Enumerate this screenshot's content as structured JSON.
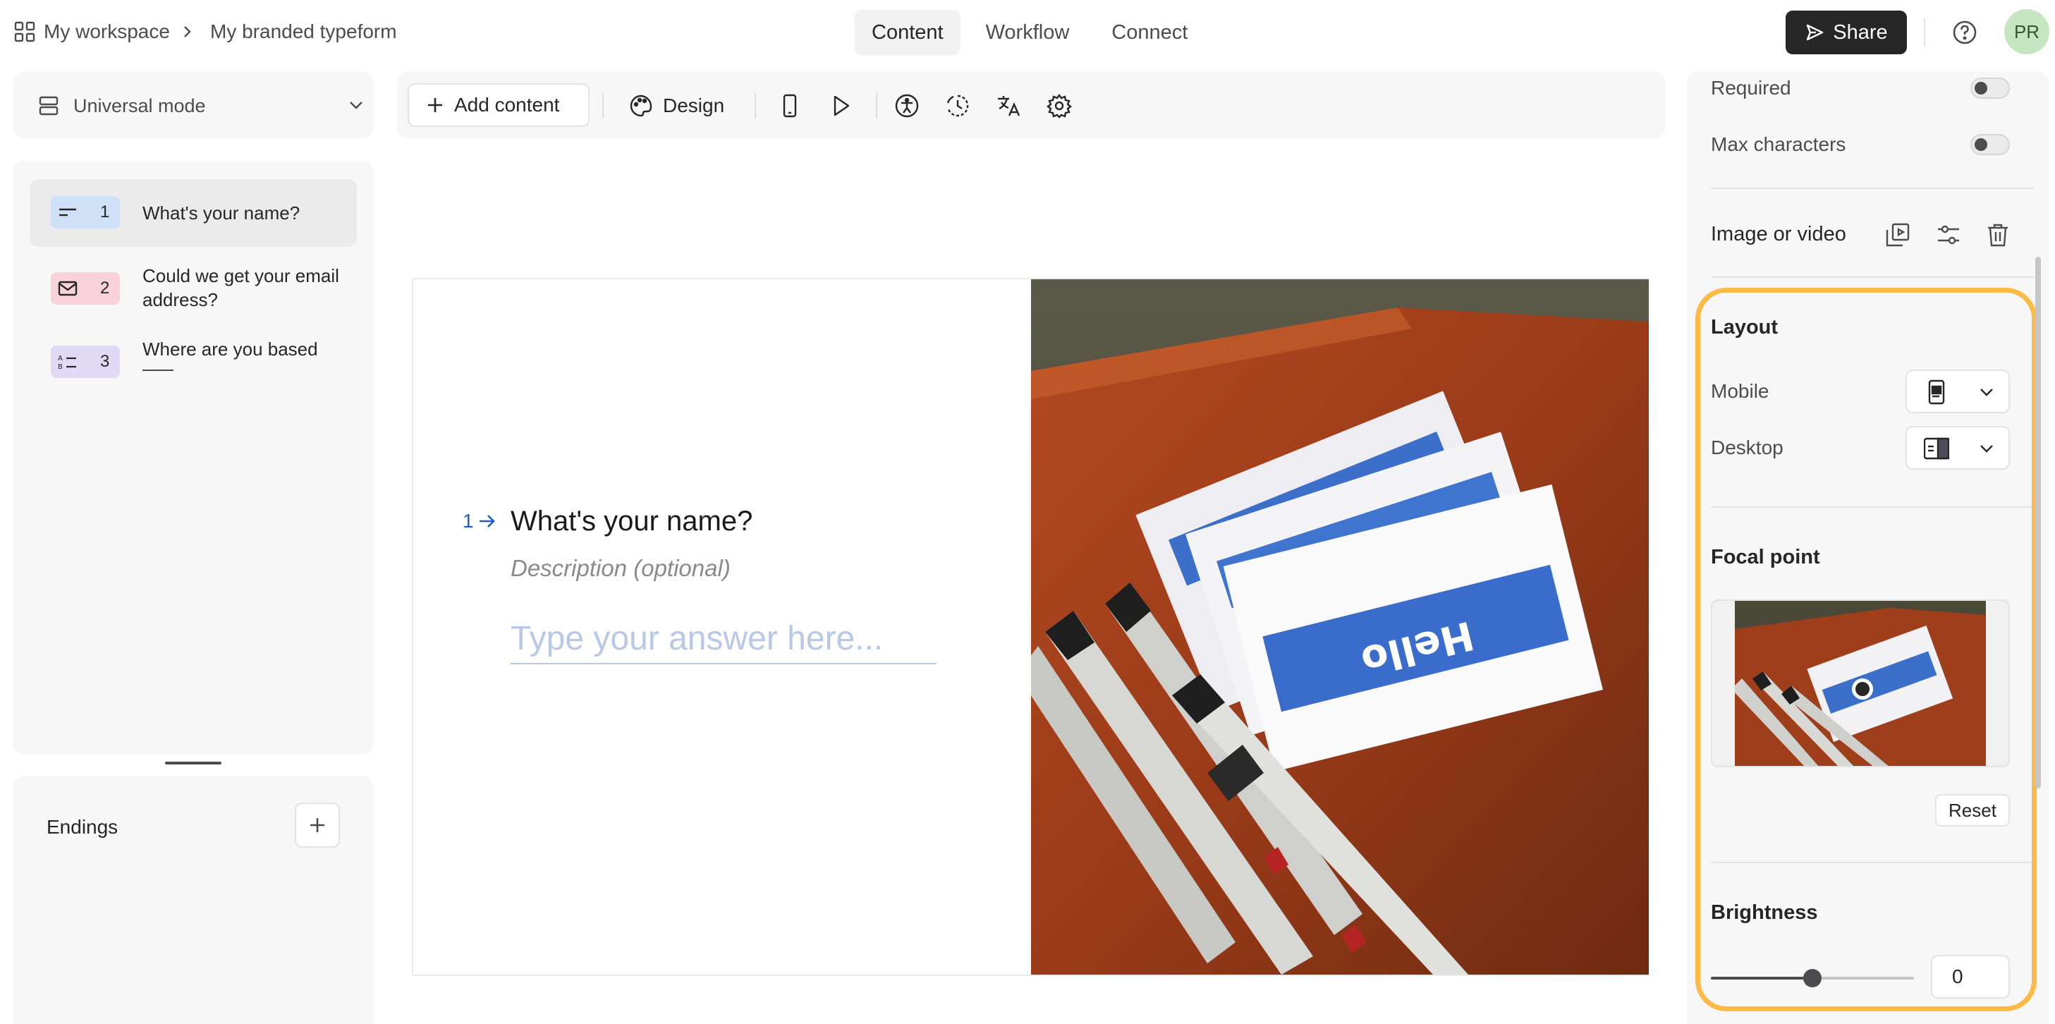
{
  "header": {
    "breadcrumb_workspace": "My workspace",
    "breadcrumb_form": "My branded typeform",
    "tabs": [
      {
        "label": "Content",
        "active": true
      },
      {
        "label": "Workflow",
        "active": false
      },
      {
        "label": "Connect",
        "active": false
      }
    ],
    "share_label": "Share",
    "avatar_initials": "PR"
  },
  "mode_select": {
    "label": "Universal mode"
  },
  "questions": [
    {
      "number": "1",
      "text": "What's your name?",
      "type": "short-text",
      "badge_color": "#cfe1f7"
    },
    {
      "number": "2",
      "text": "Could we get your email address?",
      "type": "email",
      "badge_color": "#f8d3dc"
    },
    {
      "number": "3",
      "text": "Where are you based",
      "type": "multiple-choice",
      "badge_color": "#e2d9f7"
    }
  ],
  "endings": {
    "label": "Endings"
  },
  "toolbar": {
    "add_content_label": "Add content",
    "design_label": "Design"
  },
  "preview": {
    "question_number": "1",
    "question_title": "What's your name?",
    "description_placeholder": "Description (optional)",
    "answer_placeholder": "Type your answer here..."
  },
  "settings": {
    "required_label": "Required",
    "required_on": false,
    "max_characters_label": "Max characters",
    "max_characters_on": false,
    "image_video_label": "Image or video",
    "layout_heading": "Layout",
    "mobile_label": "Mobile",
    "desktop_label": "Desktop",
    "focal_point_heading": "Focal point",
    "reset_label": "Reset",
    "brightness_heading": "Brightness",
    "brightness_value": "0",
    "brightness_fraction": 0.5
  },
  "colors": {
    "accent_highlight": "#ffb945",
    "share_bg": "#262627",
    "question_number": "#1f5fc4",
    "answer_placeholder": "#b8c8e6"
  }
}
